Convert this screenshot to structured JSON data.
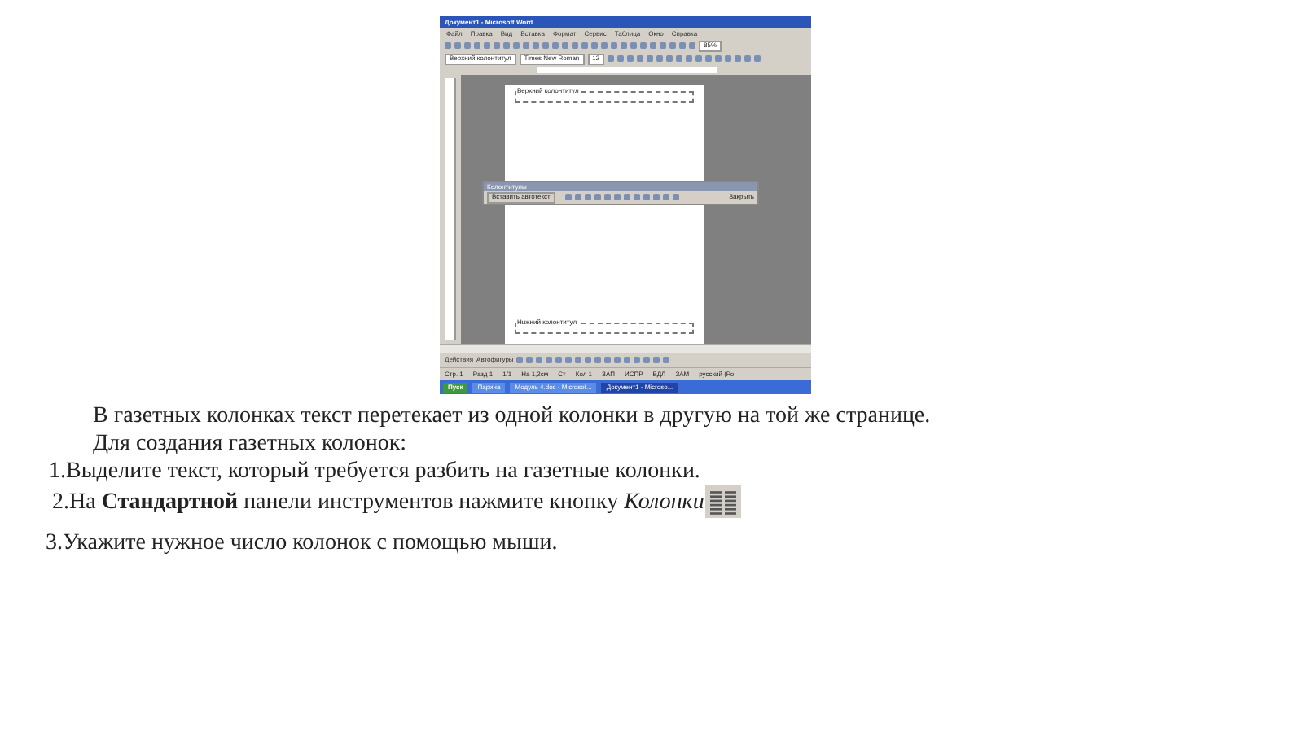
{
  "screenshot": {
    "title": "Документ1 - Microsoft Word",
    "menu": [
      "Файл",
      "Правка",
      "Вид",
      "Вставка",
      "Формат",
      "Сервис",
      "Таблица",
      "Окно",
      "Справка"
    ],
    "style_box": "Верхний колонтитул",
    "font_box": "Times New Roman",
    "size_box": "12",
    "zoom_box": "85%",
    "header_label": "Верхний колонтитул",
    "toolbar_title": "Колонтитулы",
    "toolbar_button": "Вставить автотекст",
    "close_button": "Закрыть",
    "footer_label": "Нижний колонтитул",
    "draw_menu": "Действия",
    "autoshapes": "Автофигуры",
    "status": [
      "Стр. 1",
      "Разд 1",
      "1/1",
      "На 1,2см",
      "Ст",
      "Кол 1",
      "ЗАП",
      "ИСПР",
      "ВДЛ",
      "ЗАМ",
      "русский (Ро"
    ],
    "taskbar": [
      {
        "label": "Пуск",
        "selected": false
      },
      {
        "label": "Парина",
        "selected": false
      },
      {
        "label": "Модуль 4.doc - Microsof...",
        "selected": false
      },
      {
        "label": "Документ1 - Microso...",
        "selected": true
      }
    ]
  },
  "paragraphs": [
    "В газетных колонках текст перетекает из одной колонки в другую на той же странице.",
    "Для создания газетных колонок:"
  ],
  "steps": [
    {
      "kind": "plain",
      "text": "1.Выделите текст, который требуется разбить на газетные колонки."
    },
    {
      "kind": "icon",
      "text": "2.На **Стандартной** панели инструментов нажмите кнопку *Колонки*"
    },
    {
      "kind": "plain",
      "text": "3.Укажите нужное число колонок с помощью мыши."
    }
  ]
}
